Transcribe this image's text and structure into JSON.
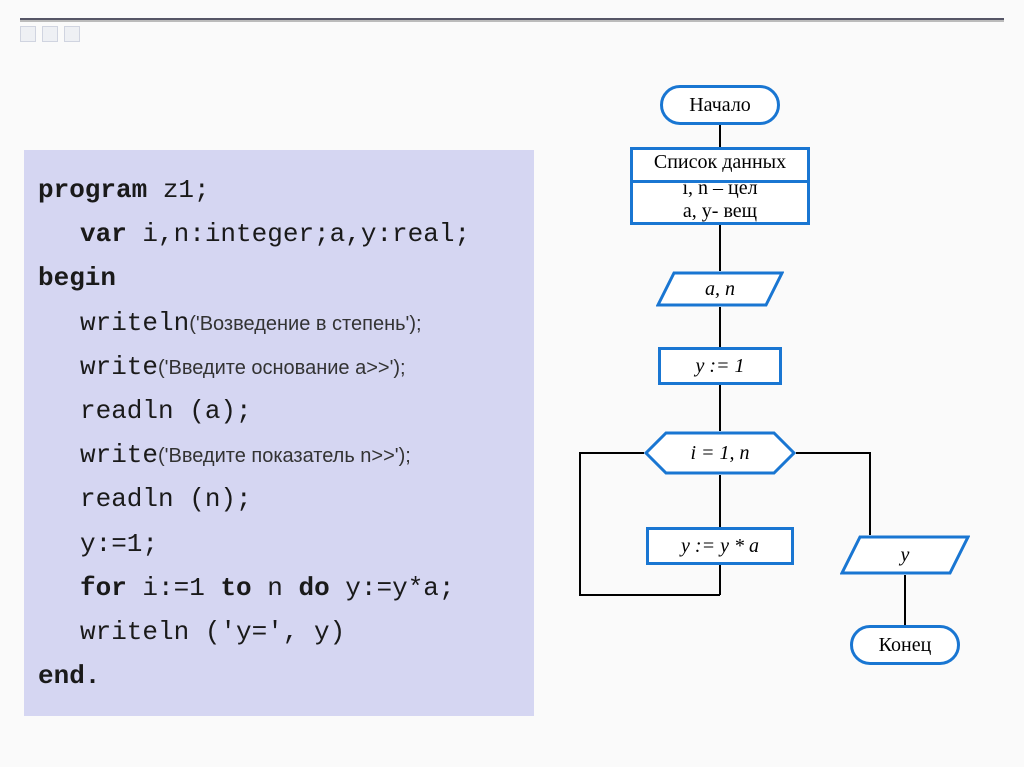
{
  "code": {
    "l1a": "program",
    "l1b": " z1;",
    "l2a": "var",
    "l2b": " i,n:integer;a,y:real;",
    "l3": "begin",
    "l4a": "writeln",
    "l4b": "('Возведение в степень');",
    "l5a": "write",
    "l5b": "('Введите основание a>>');",
    "l6": "readln (a);",
    "l7a": "write",
    "l7b": "('Введите показатель n>>');",
    "l8": "readln (n);",
    "l9": "y:=1;",
    "l10a": "for",
    "l10b": " i:=1 ",
    "l10c": "to",
    "l10d": " n ",
    "l10e": "do",
    "l10f": " y:=y*a;",
    "l11": "writeln ('y=', y)",
    "l12": "end."
  },
  "flow": {
    "start": "Начало",
    "data_title": "Список данных",
    "data_line1": "i, n – цел",
    "data_line2": "a, y- вещ",
    "input": "a, n",
    "init": "y := 1",
    "loop": "i = 1, n",
    "body": "y := y * a",
    "output": "y",
    "end": "Конец"
  }
}
